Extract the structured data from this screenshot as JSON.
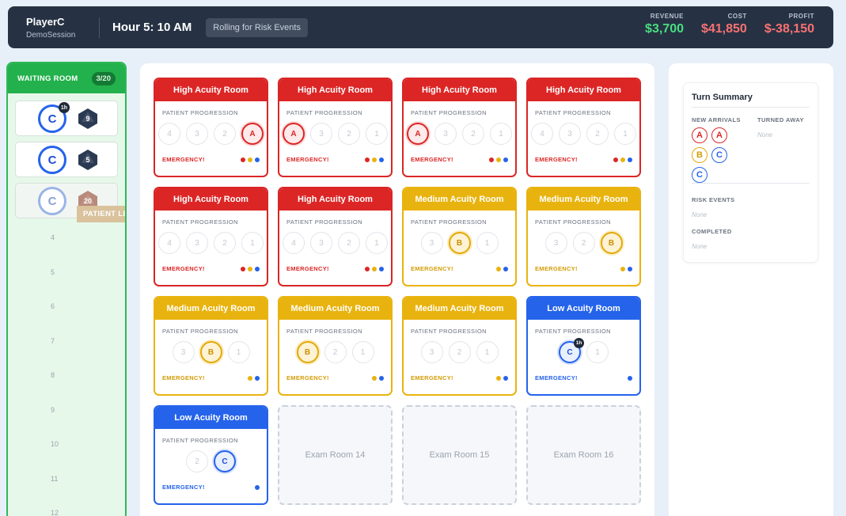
{
  "header": {
    "player_name": "PlayerC",
    "session": "DemoSession",
    "hour": "Hour 5: 10 AM",
    "status": "Rolling for Risk Events",
    "metrics": [
      {
        "label": "REVENUE",
        "value": "$3,700",
        "tone": "pos"
      },
      {
        "label": "COST",
        "value": "$41,850",
        "tone": "neg"
      },
      {
        "label": "PROFIT",
        "value": "$-38,150",
        "tone": "neg"
      }
    ]
  },
  "waiting_room": {
    "title": "WAITING ROOM",
    "count": "3/20",
    "patients": [
      {
        "type": "C",
        "badge": "1h",
        "die_value": "9",
        "die_color": "#2b3a52",
        "faded": false
      },
      {
        "type": "C",
        "badge": "",
        "die_value": "5",
        "die_color": "#2b3a52",
        "faded": false
      },
      {
        "type": "C",
        "badge": "",
        "die_value": "20",
        "die_color": "#b98a7c",
        "faded": true,
        "tag": "PATIENT LEAV"
      }
    ],
    "slot_numbers": [
      "4",
      "5",
      "6",
      "7",
      "8",
      "9",
      "10",
      "11",
      "12"
    ]
  },
  "rooms": [
    {
      "title": "High Acuity Room",
      "acuity": "high",
      "progress_label": "PATIENT PROGRESSION",
      "steps": [
        "4",
        "3",
        "2",
        "A"
      ],
      "patient_index": 3,
      "emergency": "EMERGENCY!",
      "dots": [
        "r",
        "y",
        "b"
      ]
    },
    {
      "title": "High Acuity Room",
      "acuity": "high",
      "progress_label": "PATIENT PROGRESSION",
      "steps": [
        "A",
        "3",
        "2",
        "1"
      ],
      "patient_index": 0,
      "emergency": "EMERGENCY!",
      "dots": [
        "r",
        "y",
        "b"
      ]
    },
    {
      "title": "High Acuity Room",
      "acuity": "high",
      "progress_label": "PATIENT PROGRESSION",
      "steps": [
        "A",
        "3",
        "2",
        "1"
      ],
      "patient_index": 0,
      "emergency": "EMERGENCY!",
      "dots": [
        "r",
        "y",
        "b"
      ]
    },
    {
      "title": "High Acuity Room",
      "acuity": "high",
      "progress_label": "PATIENT PROGRESSION",
      "steps": [
        "4",
        "3",
        "2",
        "1"
      ],
      "patient_index": -1,
      "emergency": "EMERGENCY!",
      "dots": [
        "r",
        "y",
        "b"
      ]
    },
    {
      "title": "High Acuity Room",
      "acuity": "high",
      "progress_label": "PATIENT PROGRESSION",
      "steps": [
        "4",
        "3",
        "2",
        "1"
      ],
      "patient_index": -1,
      "emergency": "EMERGENCY!",
      "dots": [
        "r",
        "y",
        "b"
      ]
    },
    {
      "title": "High Acuity Room",
      "acuity": "high",
      "progress_label": "PATIENT PROGRESSION",
      "steps": [
        "4",
        "3",
        "2",
        "1"
      ],
      "patient_index": -1,
      "emergency": "EMERGENCY!",
      "dots": [
        "r",
        "y",
        "b"
      ]
    },
    {
      "title": "Medium Acuity Room",
      "acuity": "med",
      "progress_label": "PATIENT PROGRESSION",
      "steps": [
        "3",
        "B",
        "1"
      ],
      "patient_index": 1,
      "emergency": "EMERGENCY!",
      "dots": [
        "y",
        "b"
      ]
    },
    {
      "title": "Medium Acuity Room",
      "acuity": "med",
      "progress_label": "PATIENT PROGRESSION",
      "steps": [
        "3",
        "2",
        "B"
      ],
      "patient_index": 2,
      "emergency": "EMERGENCY!",
      "dots": [
        "y",
        "b"
      ]
    },
    {
      "title": "Medium Acuity Room",
      "acuity": "med",
      "progress_label": "PATIENT PROGRESSION",
      "steps": [
        "3",
        "B",
        "1"
      ],
      "patient_index": 1,
      "emergency": "EMERGENCY!",
      "dots": [
        "y",
        "b"
      ]
    },
    {
      "title": "Medium Acuity Room",
      "acuity": "med",
      "progress_label": "PATIENT PROGRESSION",
      "steps": [
        "B",
        "2",
        "1"
      ],
      "patient_index": 0,
      "emergency": "EMERGENCY!",
      "dots": [
        "y",
        "b"
      ]
    },
    {
      "title": "Medium Acuity Room",
      "acuity": "med",
      "progress_label": "PATIENT PROGRESSION",
      "steps": [
        "3",
        "2",
        "1"
      ],
      "patient_index": -1,
      "emergency": "EMERGENCY!",
      "dots": [
        "y",
        "b"
      ]
    },
    {
      "title": "Low Acuity Room",
      "acuity": "low",
      "progress_label": "PATIENT PROGRESSION",
      "steps": [
        "C",
        "1"
      ],
      "patient_index": 0,
      "patient_badge": "1h",
      "emergency": "EMERGENCY!",
      "dots": [
        "b"
      ]
    },
    {
      "title": "Low Acuity Room",
      "acuity": "low",
      "progress_label": "PATIENT PROGRESSION",
      "steps": [
        "2",
        "C"
      ],
      "patient_index": 1,
      "emergency": "EMERGENCY!",
      "dots": [
        "b"
      ]
    }
  ],
  "exam_rooms": [
    "Exam Room 14",
    "Exam Room 15",
    "Exam Room 16"
  ],
  "summary": {
    "title": "Turn Summary",
    "new_arrivals_label": "NEW ARRIVALS",
    "turned_away_label": "TURNED AWAY",
    "turned_away_value": "None",
    "arrivals": [
      "A",
      "A",
      "B",
      "C",
      "C"
    ],
    "risk_events_label": "RISK EVENTS",
    "risk_events_value": "None",
    "completed_label": "COMPLETED",
    "completed_value": "None"
  }
}
